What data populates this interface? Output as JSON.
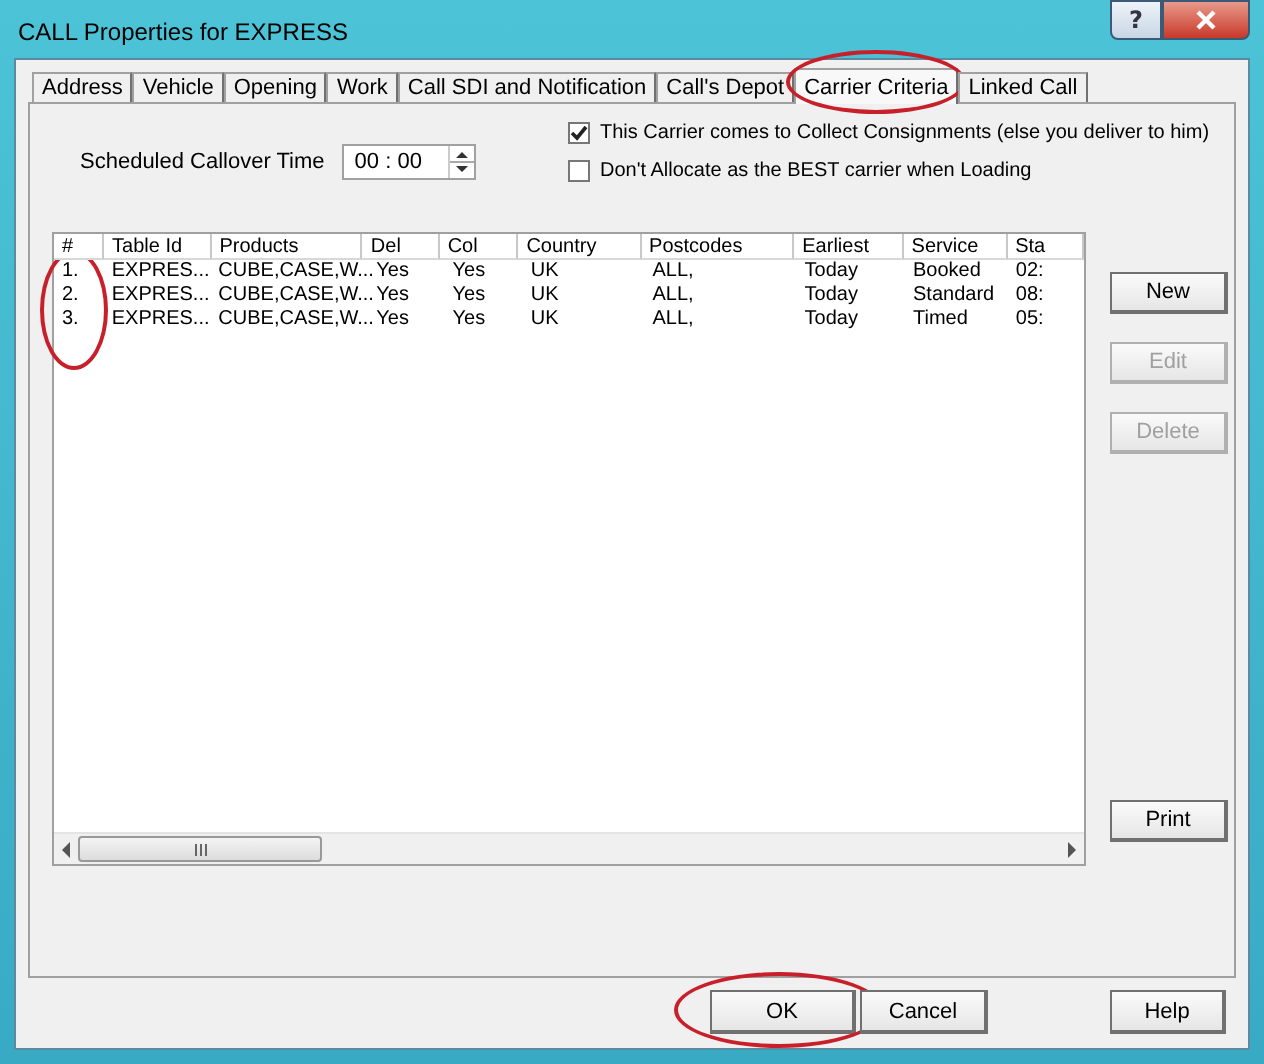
{
  "window": {
    "title": "CALL Properties for EXPRESS",
    "help_button": "?"
  },
  "tabs": [
    {
      "label": "Address",
      "selected": false,
      "circled": false
    },
    {
      "label": "Vehicle",
      "selected": false,
      "circled": false
    },
    {
      "label": "Opening",
      "selected": false,
      "circled": false
    },
    {
      "label": "Work",
      "selected": false,
      "circled": false
    },
    {
      "label": "Call SDI and Notification",
      "selected": false,
      "circled": false
    },
    {
      "label": "Call's Depot",
      "selected": false,
      "circled": false
    },
    {
      "label": "Carrier Criteria",
      "selected": true,
      "circled": true
    },
    {
      "label": "Linked Call",
      "selected": false,
      "circled": false
    }
  ],
  "callover": {
    "label": "Scheduled Callover Time",
    "value": "00 : 00"
  },
  "options": [
    {
      "label": "This Carrier comes to Collect Consignments (else you deliver to him)",
      "checked": true
    },
    {
      "label": "Don't Allocate as the BEST carrier when Loading",
      "checked": false
    }
  ],
  "table": {
    "columns": [
      {
        "label": "#",
        "circled": true
      },
      {
        "label": "Table Id",
        "circled": false
      },
      {
        "label": "Products",
        "circled": false
      },
      {
        "label": "Del",
        "circled": false
      },
      {
        "label": "Col",
        "circled": false
      },
      {
        "label": "Country",
        "circled": false
      },
      {
        "label": "Postcodes",
        "circled": false
      },
      {
        "label": "Earliest",
        "circled": false
      },
      {
        "label": "Service",
        "circled": false
      },
      {
        "label": "Sta",
        "circled": false
      }
    ],
    "rows": [
      [
        "1.",
        "EXPRES...",
        "CUBE,CASE,W...",
        "Yes",
        "Yes",
        "UK",
        "ALL,",
        "Today",
        "Booked",
        "02:"
      ],
      [
        "2.",
        "EXPRES...",
        "CUBE,CASE,W...",
        "Yes",
        "Yes",
        "UK",
        "ALL,",
        "Today",
        "Standard",
        "08:"
      ],
      [
        "3.",
        "EXPRES...",
        "CUBE,CASE,W...",
        "Yes",
        "Yes",
        "UK",
        "ALL,",
        "Today",
        "Timed",
        "05:"
      ]
    ]
  },
  "side_buttons": [
    {
      "label": "New",
      "disabled": false
    },
    {
      "label": "Edit",
      "disabled": true
    },
    {
      "label": "Delete",
      "disabled": true
    },
    {
      "label": "Print",
      "disabled": false
    }
  ],
  "dialog_buttons": [
    {
      "label": "OK",
      "circled": true
    },
    {
      "label": "Cancel",
      "circled": false
    },
    {
      "label": "Help",
      "circled": false
    }
  ]
}
